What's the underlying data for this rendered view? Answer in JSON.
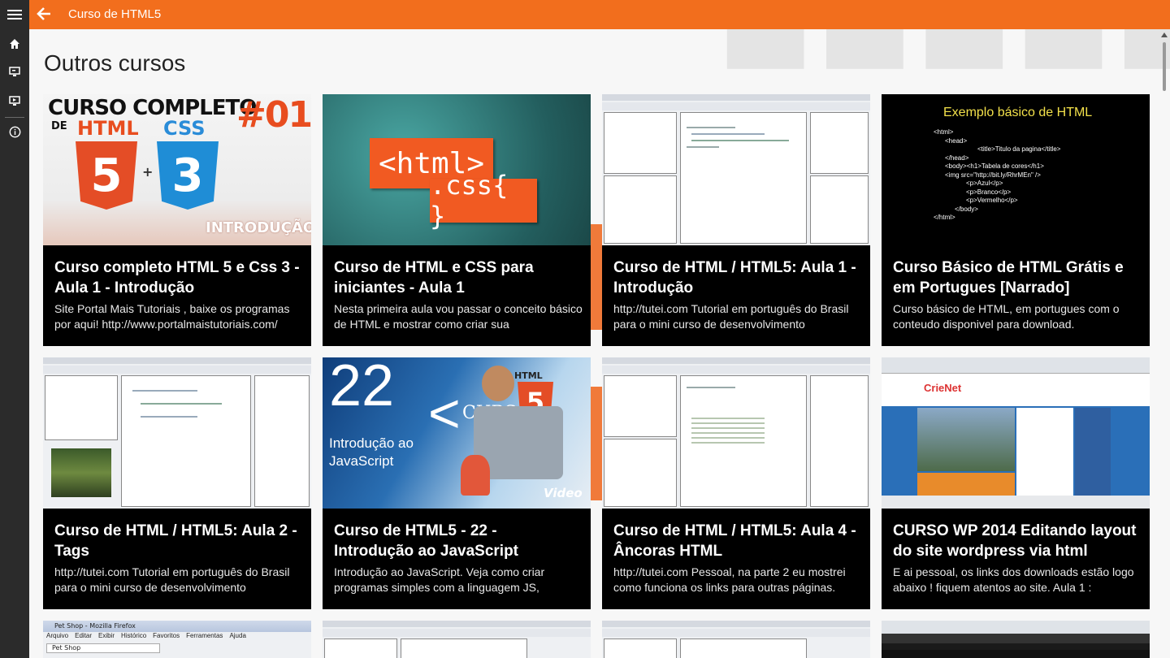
{
  "app": {
    "title": "Curso de HTML5"
  },
  "icons": {
    "menu": "hamburger-icon",
    "back": "back-arrow-icon",
    "home": "home-icon",
    "courses": "monitor-icon",
    "videos": "monitor-play-icon",
    "info": "info-icon"
  },
  "colors": {
    "accent": "#f26e1d",
    "sidebar": "#2b2b2b"
  },
  "section": {
    "title": "Outros cursos"
  },
  "cards": [
    {
      "title": "Curso completo HTML 5 e Css 3 - Aula 1 - Introdução",
      "desc": "Site Portal Mais Tutoriais , baixe os programas por aqui! http://www.portalmaistutoriais.com/",
      "thumb": {
        "headline": "CURSO COMPLETO",
        "de": "DE",
        "num": "#01",
        "html": "HTML",
        "css": "CSS",
        "five": "5",
        "three": "3",
        "sub": "INTRODUÇÃO"
      }
    },
    {
      "title": "Curso de HTML e CSS para iniciantes - Aula 1",
      "desc": "Nesta primeira aula vou passar o conceito básico de HTML e mostrar como criar sua",
      "thumb": {
        "line1": "<html>",
        "line2": ".css{ }"
      }
    },
    {
      "title": "Curso de HTML / HTML5: Aula 1 - Introdução",
      "desc": "http://tutei.com Tutorial em português do Brasil para o mini curso de desenvolvimento",
      "thumb": {}
    },
    {
      "title": "Curso Básico de HTML Grátis e em Portugues [Narrado]",
      "desc": "Curso básico de HTML, em portugues com o conteudo disponivel para download.",
      "thumb": {
        "heading": "Exemplo básico de HTML",
        "lines": [
          "<html>",
          "<head>",
          "<title>Titulo da pagina</title>",
          "</head>",
          "<body><h1>Tabela de cores</h1>",
          "<img src=\"http://bit.ly/RhrMEn\" />",
          "<p>Azul</p>",
          "<p>Branco</p>",
          "<p>Vermelho</p>",
          "</body>",
          "</html>"
        ]
      }
    },
    {
      "title": "Curso de HTML / HTML5: Aula 2 - Tags",
      "desc": "http://tutei.com Tutorial em português do Brasil para o mini curso de desenvolvimento",
      "thumb": {}
    },
    {
      "title": "Curso de HTML5 - 22 - Introdução ao JavaScript",
      "desc": "Introdução ao JavaScript. Veja como criar programas simples com a linguagem JS,",
      "thumb": {
        "num": "22",
        "l1": "Introdução ao",
        "l2": "JavaScript",
        "badge": "HTML",
        "five": "5",
        "curso": "CURSO",
        "video": "Video"
      }
    },
    {
      "title": "Curso de HTML / HTML5: Aula 4 - Âncoras HTML",
      "desc": "http://tutei.com Pessoal, na parte 2 eu mostrei como funciona os links para outras páginas.",
      "thumb": {}
    },
    {
      "title": "CURSO WP 2014 Editando layout do site wordpress via html",
      "desc": "E ai pessoal, os links dos downloads estão logo abaixo ! fiquem atentos ao site. Aula 1 :",
      "thumb": {
        "brand": "CrieNet"
      }
    }
  ],
  "row3": [
    {
      "window_title": "Pet Shop - Mozilla Firefox",
      "menu": [
        "Arquivo",
        "Editar",
        "Exibir",
        "Histórico",
        "Favoritos",
        "Ferramentas",
        "Ajuda"
      ],
      "tab": "Pet Shop"
    },
    {},
    {},
    {}
  ]
}
